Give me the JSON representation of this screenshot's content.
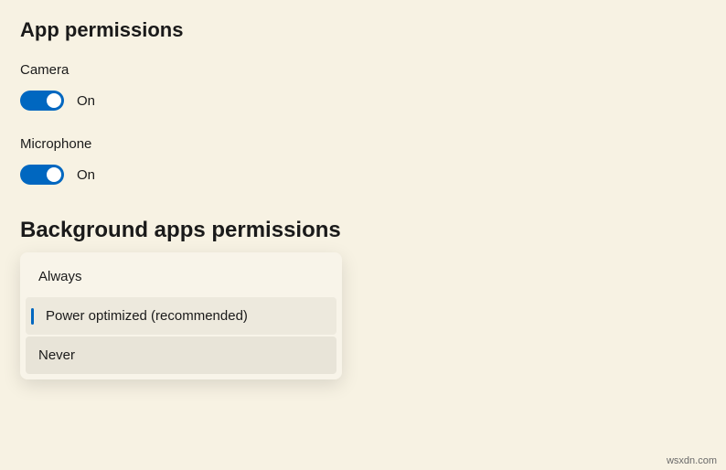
{
  "sections": {
    "app_permissions": {
      "title": "App permissions",
      "camera": {
        "label": "Camera",
        "state": "On"
      },
      "microphone": {
        "label": "Microphone",
        "state": "On"
      }
    },
    "background_apps": {
      "title": "Background apps permissions",
      "options": {
        "always": "Always",
        "power_optimized": "Power optimized (recommended)",
        "never": "Never"
      }
    }
  },
  "watermark": "wsxdn.com"
}
